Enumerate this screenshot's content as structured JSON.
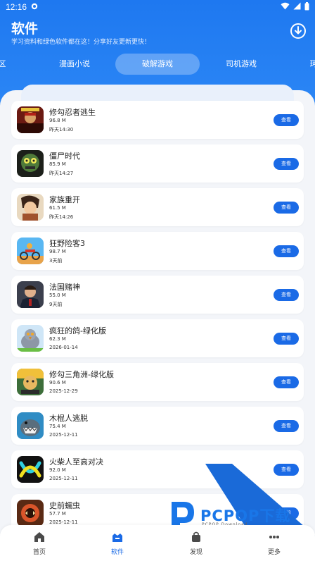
{
  "status_bar": {
    "time": "12:16"
  },
  "header": {
    "title": "软件",
    "subtitle": "学习资料和绿色软件都在这！分享好友更新更快！"
  },
  "tabs": [
    {
      "label": "区"
    },
    {
      "label": "漫画小说"
    },
    {
      "label": "破解游戏",
      "active": true
    },
    {
      "label": "司机游戏"
    },
    {
      "label": "珂"
    }
  ],
  "apps": [
    {
      "name": "修勾忍者逃生",
      "size": "96.8 M",
      "date": "昨天14:30",
      "button": "查看",
      "icon": "ninja-game-icon"
    },
    {
      "name": "僵尸时代",
      "size": "85.9 M",
      "date": "昨天14:27",
      "button": "查看",
      "icon": "zombie-game-icon"
    },
    {
      "name": "家族重开",
      "size": "61.5 M",
      "date": "昨天14:26",
      "button": "查看",
      "icon": "family-game-icon"
    },
    {
      "name": "狂野险客3",
      "size": "98.7 M",
      "date": "3天前",
      "button": "查看",
      "icon": "bike-game-icon"
    },
    {
      "name": "法国赌神",
      "size": "55.0 M",
      "date": "9天前",
      "button": "查看",
      "icon": "gambler-game-icon"
    },
    {
      "name": "疯狂的鸽-绿化版",
      "size": "62.3 M",
      "date": "2026-01-14",
      "button": "查看",
      "icon": "pigeon-game-icon"
    },
    {
      "name": "修勾三角洲-绿化版",
      "size": "90.6 M",
      "date": "2025-12-29",
      "button": "查看",
      "icon": "dog-delta-game-icon"
    },
    {
      "name": "木棍人逃脱",
      "size": "75.4 M",
      "date": "2025-12-11",
      "button": "查看",
      "icon": "shark-game-icon"
    },
    {
      "name": "火柴人至高对决",
      "size": "92.0 M",
      "date": "2025-12-11",
      "button": "查看",
      "icon": "stickman-game-icon"
    },
    {
      "name": "史前蠕虫",
      "size": "57.7 M",
      "date": "2025-12-11",
      "button": "查看",
      "icon": "worm-game-icon"
    }
  ],
  "bottom_nav": [
    {
      "label": "首页",
      "icon": "home-icon"
    },
    {
      "label": "软件",
      "icon": "software-icon",
      "active": true
    },
    {
      "label": "发现",
      "icon": "discover-bag-icon"
    },
    {
      "label": "更多",
      "icon": "more-icon"
    }
  ],
  "watermark": {
    "text": "PCPOP下载",
    "sub": "PCPOP Download"
  },
  "colors": {
    "primary": "#1e78f0",
    "button": "#1a6ae6",
    "background": "#f3f5f9"
  }
}
